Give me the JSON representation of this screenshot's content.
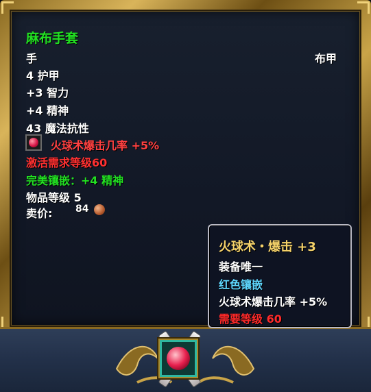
{
  "item": {
    "name": "麻布手套",
    "slot": "手",
    "armor_type": "布甲",
    "stats": [
      "4 护甲",
      "+3 智力",
      "+4 精神",
      "43 魔法抗性"
    ],
    "gem_effect": "火球术爆击几率 +5%",
    "requirement": "激活需求等级60",
    "socket_bonus": "完美镶嵌：+4 精神",
    "item_level": "物品等级 5",
    "sell_label": "卖价:",
    "sell_amount": "84"
  },
  "gem_tooltip": {
    "title": "火球术・爆击 +3",
    "unique": "装备唯一",
    "socket_color": "红色镶嵌",
    "effect": "火球术爆击几率 +5%",
    "requirement": "需要等级 60"
  },
  "colors": {
    "item_name": "#22e022",
    "requirement": "#ff3030",
    "tooltip_title": "#f5d26a",
    "socket_color": "#5fd8ff"
  },
  "icons": [
    "red-gem-icon",
    "copper-coin-icon",
    "socketed-red-gem-icon"
  ]
}
